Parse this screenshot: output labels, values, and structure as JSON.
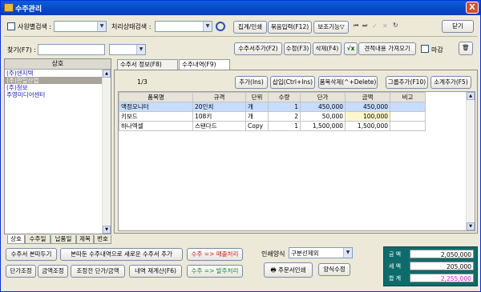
{
  "window": {
    "title": "수주관리",
    "close_label": "X"
  },
  "toolbar1": {
    "customer_search_label": "사원별검색 :",
    "status_search_label": "처리상태검색 :",
    "aggregate_print": "집계/인쇄",
    "bundle_input": "묶음입력(F12)",
    "aux_function": "보조기능▽",
    "close": "닫기"
  },
  "toolbar2": {
    "find_label": "찾기(F7) :",
    "add_order": "수주서추가(F2)",
    "edit": "수정(F3)",
    "delete": "삭제(F4)",
    "import_quote": "견적내용 가져오기",
    "deadline_label": "마감"
  },
  "customer_list": {
    "header": "상호",
    "items": [
      "(주)엔지텍",
      "(주)한일산업",
      "(주)청보",
      "주영미디어센터"
    ],
    "selected_index": 1
  },
  "left_tabs": [
    "상호",
    "수주일",
    "납품일",
    "제목",
    "번호"
  ],
  "tabs": [
    "수주서 정보(F8)",
    "수주내역(F9)"
  ],
  "active_tab": 1,
  "detail": {
    "page": "1/3",
    "add": "추가(Ins)",
    "insert": "삽입(Ctrl+Ins)",
    "delete_item": "품목삭제(^+Delete)",
    "group_add": "그룹추가(F10)",
    "subtotal_add": "소계추가(F5)"
  },
  "grid": {
    "columns": [
      "품목명",
      "규격",
      "단위",
      "수량",
      "단가",
      "금액",
      "비고"
    ],
    "rows": [
      [
        "액정모니터",
        "20인치",
        "개",
        "1",
        "450,000",
        "450,000",
        ""
      ],
      [
        "키보드",
        "108키",
        "개",
        "2",
        "50,000",
        "100,000",
        ""
      ],
      [
        "하나엑셀",
        "스탠다드",
        "Copy",
        "1",
        "1,500,000",
        "1,500,000",
        ""
      ]
    ]
  },
  "bottom": {
    "copy_order": "수주서 본따두기",
    "new_from_copy": "본따둔 수주내역으로 새로운 수주서 추가",
    "to_sales": "수주 => 매출처리",
    "unit_adjust": "단가조정",
    "amount_adjust": "금액조정",
    "pre_adjust": "조정전 단가/금액",
    "recalc": "내역 재계산(F6)",
    "to_order": "수주 => 발주처리",
    "print_form_label": "인쇄양식",
    "print_form_value": "구분선제외",
    "print_order": "주문서인쇄",
    "edit_form": "양식수정"
  },
  "summary": {
    "amount_label": "금 액",
    "amount": "2,050,000",
    "tax_label": "세 액",
    "tax": "205,000",
    "total_label": "합 계",
    "total": "2,255,000"
  },
  "colors": {
    "title_bar": "#0a5fd8",
    "selected_row": "#c7dcff",
    "summary_bg": "#0e6b6b",
    "accent_red": "#cc1a1a",
    "accent_green": "#1a8a1a"
  }
}
